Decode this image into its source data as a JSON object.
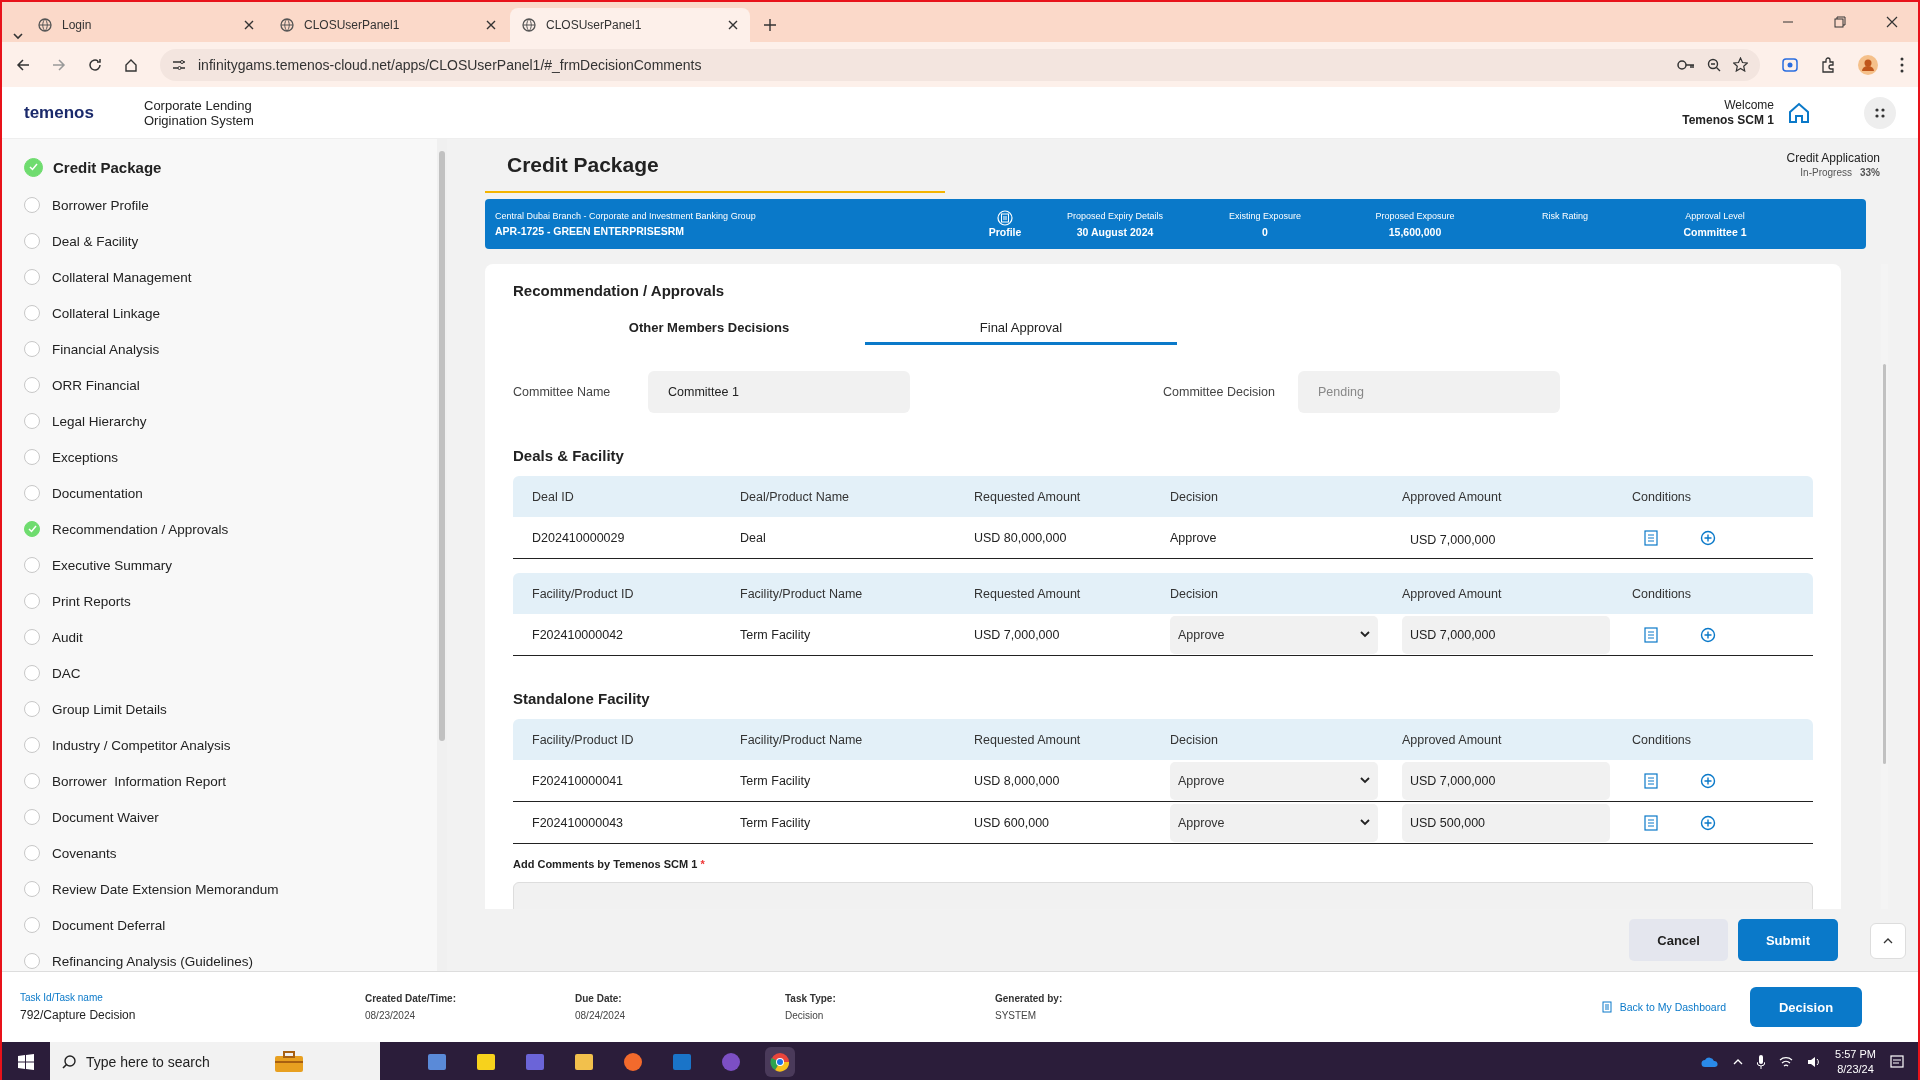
{
  "browser": {
    "tabs": [
      {
        "title": "Login",
        "selected": false
      },
      {
        "title": "CLOSUserPanel1",
        "selected": false
      },
      {
        "title": "CLOSUserPanel1",
        "selected": true
      }
    ],
    "url": "infinitygams.temenos-cloud.net/apps/CLOSUserPanel1/#_frmDecisionComments"
  },
  "app_header": {
    "logo": "temenos",
    "system_name": "Corporate Lending Origination System",
    "welcome": "Welcome",
    "user": "Temenos SCM 1"
  },
  "sidebar": {
    "title": "Credit Package",
    "title_done": true,
    "items": [
      {
        "label": "Borrower Profile",
        "done": false
      },
      {
        "label": "Deal & Facility",
        "done": false
      },
      {
        "label": "Collateral Management",
        "done": false
      },
      {
        "label": "Collateral Linkage",
        "done": false
      },
      {
        "label": "Financial Analysis",
        "done": false
      },
      {
        "label": "ORR Financial",
        "done": false
      },
      {
        "label": "Legal Hierarchy",
        "done": false
      },
      {
        "label": "Exceptions",
        "done": false
      },
      {
        "label": "Documentation",
        "done": false
      },
      {
        "label": "Recommendation / Approvals",
        "done": true
      },
      {
        "label": "Executive Summary",
        "done": false
      },
      {
        "label": "Print Reports",
        "done": false
      },
      {
        "label": "Audit",
        "done": false
      },
      {
        "label": "DAC",
        "done": false
      },
      {
        "label": "Group Limit Details",
        "done": false
      },
      {
        "label": "Industry / Competitor Analysis",
        "done": false
      },
      {
        "label": "Borrower  Information Report",
        "done": false
      },
      {
        "label": "Document Waiver",
        "done": false
      },
      {
        "label": "Covenants",
        "done": false
      },
      {
        "label": "Review Date Extension Memorandum",
        "done": false
      },
      {
        "label": "Document Deferral",
        "done": false
      },
      {
        "label": "Refinancing Analysis (Guidelines)",
        "done": false
      }
    ]
  },
  "page": {
    "title": "Credit Package",
    "application_label": "Credit Application",
    "status": "In-Progress",
    "percent": "33%"
  },
  "summary": {
    "branch": "Central Dubai Branch - Corporate and Investment Banking Group",
    "name": "APR-1725 - GREEN ENTERPRISESRM",
    "profile": "Profile",
    "fields": [
      {
        "label": "Proposed Expiry Details",
        "value": "30 August 2024"
      },
      {
        "label": "Existing Exposure",
        "value": "0"
      },
      {
        "label": "Proposed Exposure",
        "value": "15,600,000"
      },
      {
        "label": "Risk Rating"
      },
      {
        "label": "Approval Level",
        "value": "Committee 1"
      }
    ]
  },
  "section": {
    "title": "Recommendation / Approvals",
    "tabs": [
      {
        "label": "Other Members Decisions",
        "selected": false
      },
      {
        "label": "Final Approval",
        "selected": true
      }
    ],
    "fields": [
      {
        "label": "Committee Name",
        "value": "Committee 1",
        "disabled": false
      },
      {
        "label": "Committee Decision",
        "value": "Pending",
        "disabled": true
      }
    ]
  },
  "groups": [
    {
      "title": "Deals & Facility",
      "tables": [
        {
          "columns": [
            "Deal ID",
            "Deal/Product Name",
            "Requested Amount",
            "Decision",
            "Approved Amount",
            "Conditions"
          ],
          "rows": [
            {
              "kind": "readonly",
              "id": "D202410000029",
              "name": "Deal",
              "requested": "USD 80,000,000",
              "decision": "Approve",
              "approved": "USD 7,000,000"
            }
          ]
        },
        {
          "columns": [
            "Facility/Product ID",
            "Facility/Product Name",
            "Requested Amount",
            "Decision",
            "Approved Amount",
            "Conditions"
          ],
          "rows": [
            {
              "kind": "editable",
              "id": "F202410000042",
              "name": "Term Facility",
              "requested": "USD 7,000,000",
              "decision": "Approve",
              "approved": "USD 7,000,000"
            }
          ]
        }
      ]
    },
    {
      "title": "Standalone Facility",
      "tables": [
        {
          "columns": [
            "Facility/Product ID",
            "Facility/Product Name",
            "Requested Amount",
            "Decision",
            "Approved Amount",
            "Conditions"
          ],
          "rows": [
            {
              "kind": "editable",
              "id": "F202410000041",
              "name": "Term Facility",
              "requested": "USD 8,000,000",
              "decision": "Approve",
              "approved": "USD 7,000,000"
            },
            {
              "kind": "editable",
              "id": "F202410000043",
              "name": "Term Facility",
              "requested": "USD 600,000",
              "decision": "Approve",
              "approved": "USD 500,000"
            }
          ]
        }
      ]
    }
  ],
  "comments": {
    "label": "Add Comments by Temenos SCM 1",
    "required": true,
    "required_mark": "*"
  },
  "actions": [
    {
      "label": "Cancel",
      "kind": "secondary"
    },
    {
      "label": "Submit",
      "kind": "primary"
    }
  ],
  "task_info": {
    "fields": [
      {
        "label": "Task Id/Task name",
        "value": "792/Capture Decision",
        "kind": "link"
      },
      {
        "label": "Created Date/Time:",
        "value": "08/23/2024",
        "kind": "plain"
      },
      {
        "label": "Due Date:",
        "value": "08/24/2024",
        "kind": "plain"
      },
      {
        "label": "Task Type:",
        "value": "Decision",
        "kind": "plain"
      },
      {
        "label": "Generated by:",
        "value": "SYSTEM",
        "kind": "plain"
      }
    ],
    "back_link": "Back to My Dashboard",
    "decision_button": "Decision"
  },
  "taskbar": {
    "search_placeholder": "Type here to search",
    "time": "5:57 PM",
    "date": "8/23/24"
  }
}
